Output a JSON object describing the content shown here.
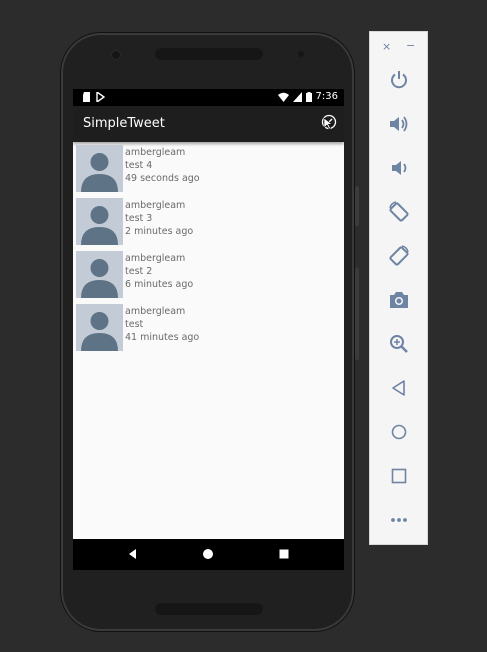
{
  "status_bar": {
    "time": "7:36"
  },
  "app_bar": {
    "title": "SimpleTweet"
  },
  "tweets": [
    {
      "user": "ambergleam",
      "text": "test 4",
      "time": "49 seconds ago"
    },
    {
      "user": "ambergleam",
      "text": "test 3",
      "time": "2 minutes ago"
    },
    {
      "user": "ambergleam",
      "text": "test 2",
      "time": "6 minutes ago"
    },
    {
      "user": "ambergleam",
      "text": "test",
      "time": "41 minutes ago"
    }
  ],
  "emulator_toolbar": {
    "window_controls": {
      "close": "×",
      "minimize": "−"
    },
    "buttons": [
      "power-icon",
      "volume-up-icon",
      "volume-down-icon",
      "rotate-left-icon",
      "rotate-right-icon",
      "camera-icon",
      "zoom-icon",
      "back-icon",
      "home-icon",
      "overview-icon",
      "more-icon"
    ]
  },
  "colors": {
    "app_bar": "#1e1e1e",
    "avatar_bg": "#c3ccd6",
    "avatar_fg": "#5f7387",
    "toolbar_icon": "#6e84a3"
  }
}
